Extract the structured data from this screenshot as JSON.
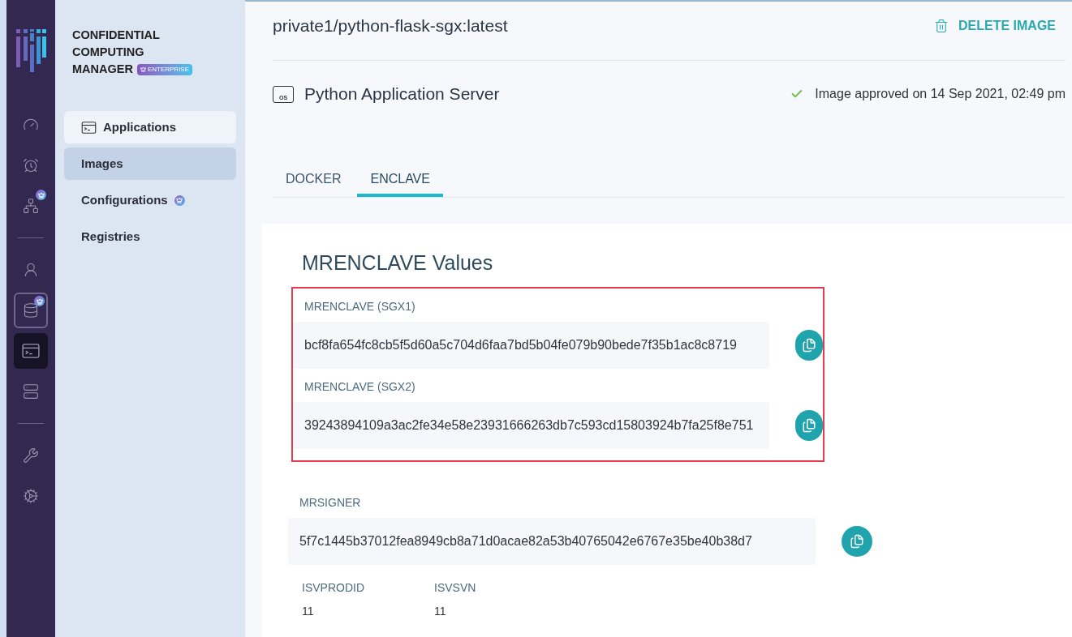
{
  "rail": {
    "groups": [
      [
        {
          "selected": false,
          "badge": false
        },
        {
          "selected": false,
          "badge": false
        },
        {
          "selected": false,
          "badge": true
        }
      ],
      [
        {
          "selected": false,
          "badge": false
        },
        {
          "selected": false,
          "badge": true,
          "outlined": true
        },
        {
          "selected": true,
          "badge": false
        },
        {
          "selected": false,
          "badge": false
        }
      ],
      [
        {
          "selected": false,
          "badge": false
        },
        {
          "selected": false,
          "badge": false
        }
      ]
    ]
  },
  "brand": {
    "title_lines": [
      "CONFIDENTIAL",
      "COMPUTING",
      "MANAGER"
    ],
    "badge": "ENTERPRISE"
  },
  "nav": [
    {
      "label": "Applications",
      "kind": "header",
      "selected": false,
      "badge": false
    },
    {
      "label": "Images",
      "kind": "item",
      "selected": true,
      "badge": false
    },
    {
      "label": "Configurations",
      "kind": "item",
      "selected": false,
      "badge": true
    },
    {
      "label": "Registries",
      "kind": "item",
      "selected": false,
      "badge": false
    }
  ],
  "image": {
    "name": "private1/python-flask-sgx:latest",
    "delete": "DELETE IMAGE",
    "app": "Python Application Server",
    "app_icon": "OS",
    "status": "Image approved on 14 Sep 2021, 02:49 pm"
  },
  "tabs": [
    {
      "label": "DOCKER",
      "selected": false
    },
    {
      "label": "ENCLAVE",
      "selected": true
    }
  ],
  "card": {
    "title": "MRENCLAVE Values",
    "fields": [
      {
        "label": "MRENCLAVE (SGX1)",
        "value": "bcf8fa654fc8cb5f5d60a5c704d6faa7bd5b04fe079b90bede7f35b1ac8c8719",
        "highlighted": true
      },
      {
        "label": "MRENCLAVE (SGX2)",
        "value": "39243894109a3ac2fe34e58e23931666263db7c593cd15803924b7fa25f8e751",
        "highlighted": true
      },
      {
        "label": "MRSIGNER",
        "value": "5f7c1445b37012fea8949cb8a71d0acae82a53b40765042e6767e35be40b38d7",
        "highlighted": false
      }
    ],
    "small": [
      {
        "label": "ISVPRODID",
        "value": "11"
      },
      {
        "label": "ISVSVN",
        "value": "11"
      }
    ]
  }
}
